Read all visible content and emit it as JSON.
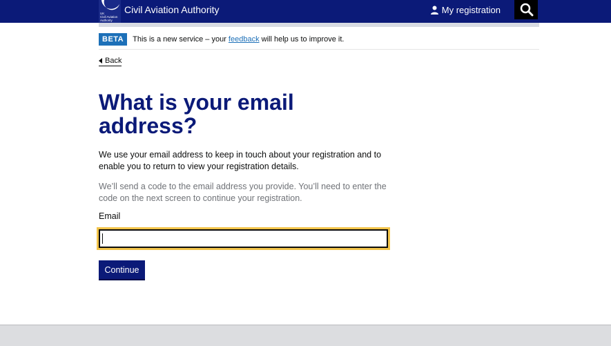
{
  "header": {
    "logo_small_text": "UK\nCivil Aviation\nAuthority",
    "org_name": "Civil Aviation Authority",
    "my_registration": "My registration",
    "background": "#0b1a78"
  },
  "beta": {
    "tag": "BETA",
    "text_before": "This is a new service – your ",
    "link": "feedback",
    "text_after": " will help us to improve it."
  },
  "back_link": "Back",
  "heading": "What is your email address?",
  "intro": "We use your email address to keep in touch about your registration and to enable you to return to view your registration details.",
  "hint": "We’ll send a code to the email address you provide. You’ll need to enter the code on the next screen to continue your registration.",
  "email": {
    "label": "Email",
    "value": "",
    "placeholder": ""
  },
  "continue_label": "Continue",
  "colors": {
    "brand": "#0b1a78",
    "link": "#1d70b8",
    "focus": "#f2c44a"
  }
}
